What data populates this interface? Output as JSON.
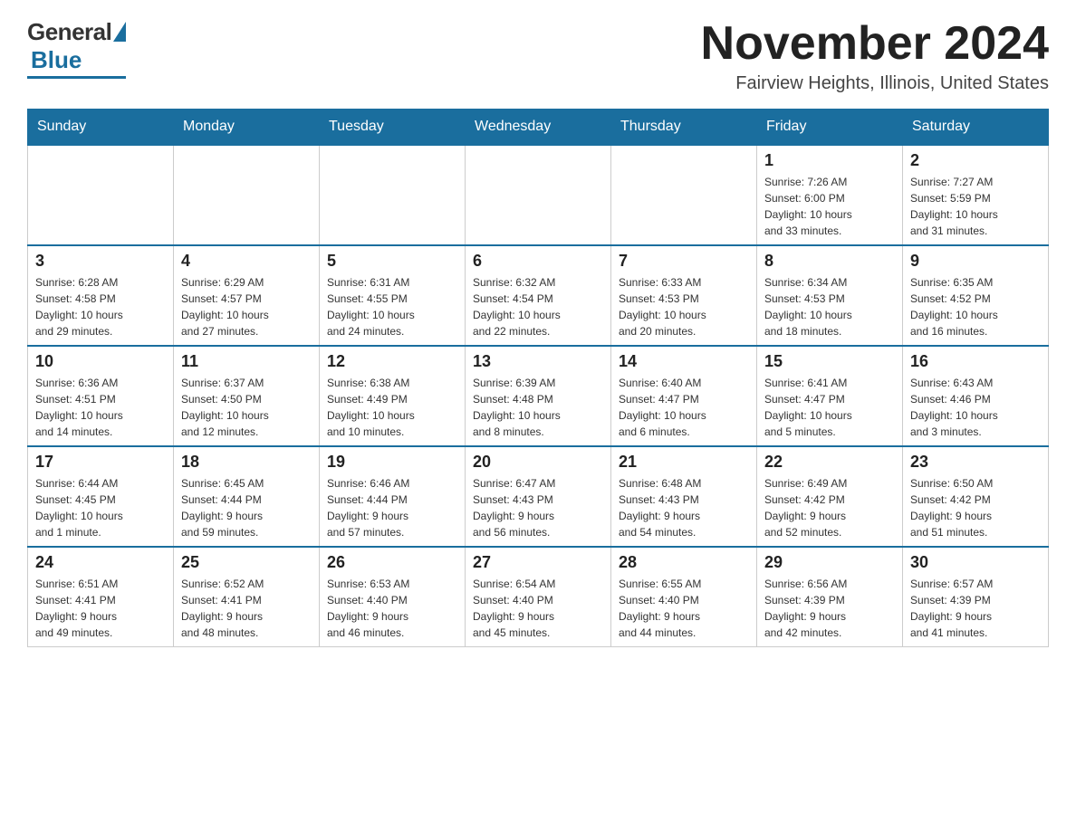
{
  "logo": {
    "general": "General",
    "blue": "Blue"
  },
  "header": {
    "month": "November 2024",
    "location": "Fairview Heights, Illinois, United States"
  },
  "weekdays": [
    "Sunday",
    "Monday",
    "Tuesday",
    "Wednesday",
    "Thursday",
    "Friday",
    "Saturday"
  ],
  "weeks": [
    [
      {
        "day": "",
        "info": ""
      },
      {
        "day": "",
        "info": ""
      },
      {
        "day": "",
        "info": ""
      },
      {
        "day": "",
        "info": ""
      },
      {
        "day": "",
        "info": ""
      },
      {
        "day": "1",
        "info": "Sunrise: 7:26 AM\nSunset: 6:00 PM\nDaylight: 10 hours\nand 33 minutes."
      },
      {
        "day": "2",
        "info": "Sunrise: 7:27 AM\nSunset: 5:59 PM\nDaylight: 10 hours\nand 31 minutes."
      }
    ],
    [
      {
        "day": "3",
        "info": "Sunrise: 6:28 AM\nSunset: 4:58 PM\nDaylight: 10 hours\nand 29 minutes."
      },
      {
        "day": "4",
        "info": "Sunrise: 6:29 AM\nSunset: 4:57 PM\nDaylight: 10 hours\nand 27 minutes."
      },
      {
        "day": "5",
        "info": "Sunrise: 6:31 AM\nSunset: 4:55 PM\nDaylight: 10 hours\nand 24 minutes."
      },
      {
        "day": "6",
        "info": "Sunrise: 6:32 AM\nSunset: 4:54 PM\nDaylight: 10 hours\nand 22 minutes."
      },
      {
        "day": "7",
        "info": "Sunrise: 6:33 AM\nSunset: 4:53 PM\nDaylight: 10 hours\nand 20 minutes."
      },
      {
        "day": "8",
        "info": "Sunrise: 6:34 AM\nSunset: 4:53 PM\nDaylight: 10 hours\nand 18 minutes."
      },
      {
        "day": "9",
        "info": "Sunrise: 6:35 AM\nSunset: 4:52 PM\nDaylight: 10 hours\nand 16 minutes."
      }
    ],
    [
      {
        "day": "10",
        "info": "Sunrise: 6:36 AM\nSunset: 4:51 PM\nDaylight: 10 hours\nand 14 minutes."
      },
      {
        "day": "11",
        "info": "Sunrise: 6:37 AM\nSunset: 4:50 PM\nDaylight: 10 hours\nand 12 minutes."
      },
      {
        "day": "12",
        "info": "Sunrise: 6:38 AM\nSunset: 4:49 PM\nDaylight: 10 hours\nand 10 minutes."
      },
      {
        "day": "13",
        "info": "Sunrise: 6:39 AM\nSunset: 4:48 PM\nDaylight: 10 hours\nand 8 minutes."
      },
      {
        "day": "14",
        "info": "Sunrise: 6:40 AM\nSunset: 4:47 PM\nDaylight: 10 hours\nand 6 minutes."
      },
      {
        "day": "15",
        "info": "Sunrise: 6:41 AM\nSunset: 4:47 PM\nDaylight: 10 hours\nand 5 minutes."
      },
      {
        "day": "16",
        "info": "Sunrise: 6:43 AM\nSunset: 4:46 PM\nDaylight: 10 hours\nand 3 minutes."
      }
    ],
    [
      {
        "day": "17",
        "info": "Sunrise: 6:44 AM\nSunset: 4:45 PM\nDaylight: 10 hours\nand 1 minute."
      },
      {
        "day": "18",
        "info": "Sunrise: 6:45 AM\nSunset: 4:44 PM\nDaylight: 9 hours\nand 59 minutes."
      },
      {
        "day": "19",
        "info": "Sunrise: 6:46 AM\nSunset: 4:44 PM\nDaylight: 9 hours\nand 57 minutes."
      },
      {
        "day": "20",
        "info": "Sunrise: 6:47 AM\nSunset: 4:43 PM\nDaylight: 9 hours\nand 56 minutes."
      },
      {
        "day": "21",
        "info": "Sunrise: 6:48 AM\nSunset: 4:43 PM\nDaylight: 9 hours\nand 54 minutes."
      },
      {
        "day": "22",
        "info": "Sunrise: 6:49 AM\nSunset: 4:42 PM\nDaylight: 9 hours\nand 52 minutes."
      },
      {
        "day": "23",
        "info": "Sunrise: 6:50 AM\nSunset: 4:42 PM\nDaylight: 9 hours\nand 51 minutes."
      }
    ],
    [
      {
        "day": "24",
        "info": "Sunrise: 6:51 AM\nSunset: 4:41 PM\nDaylight: 9 hours\nand 49 minutes."
      },
      {
        "day": "25",
        "info": "Sunrise: 6:52 AM\nSunset: 4:41 PM\nDaylight: 9 hours\nand 48 minutes."
      },
      {
        "day": "26",
        "info": "Sunrise: 6:53 AM\nSunset: 4:40 PM\nDaylight: 9 hours\nand 46 minutes."
      },
      {
        "day": "27",
        "info": "Sunrise: 6:54 AM\nSunset: 4:40 PM\nDaylight: 9 hours\nand 45 minutes."
      },
      {
        "day": "28",
        "info": "Sunrise: 6:55 AM\nSunset: 4:40 PM\nDaylight: 9 hours\nand 44 minutes."
      },
      {
        "day": "29",
        "info": "Sunrise: 6:56 AM\nSunset: 4:39 PM\nDaylight: 9 hours\nand 42 minutes."
      },
      {
        "day": "30",
        "info": "Sunrise: 6:57 AM\nSunset: 4:39 PM\nDaylight: 9 hours\nand 41 minutes."
      }
    ]
  ]
}
